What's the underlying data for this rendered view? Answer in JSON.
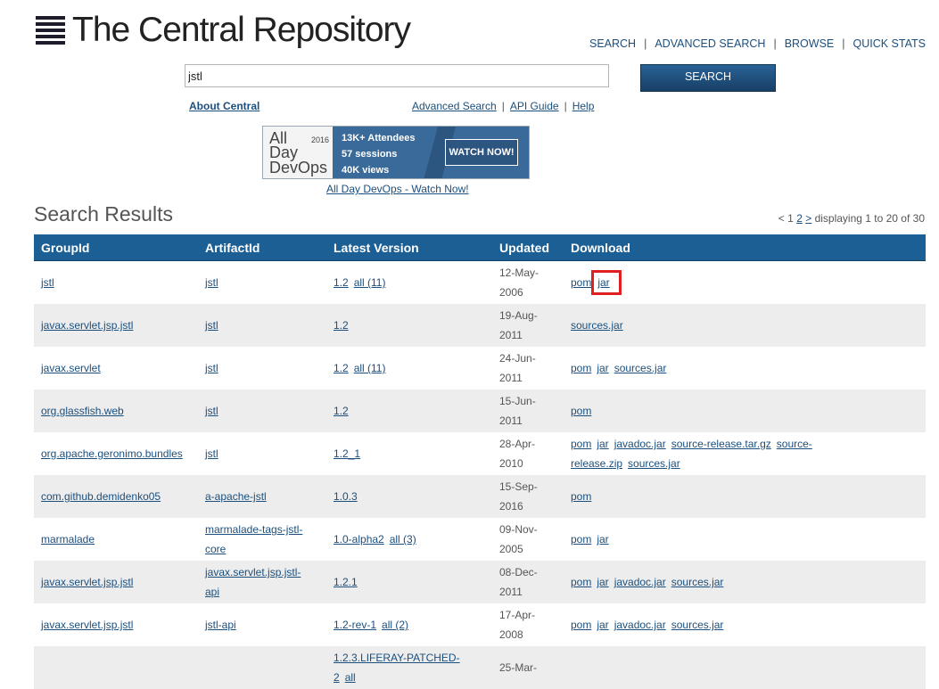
{
  "site": {
    "title": "The Central Repository"
  },
  "topnav": [
    "SEARCH",
    "ADVANCED SEARCH",
    "BROWSE",
    "QUICK STATS"
  ],
  "search": {
    "value": "jstl",
    "button_label": "SEARCH"
  },
  "about_link": "About Central",
  "sublinks": [
    "Advanced Search",
    "API Guide",
    "Help"
  ],
  "banner": {
    "brand_line1": "All",
    "brand_line2": "Day",
    "brand_line3": "DevOps",
    "year": "2016",
    "stat1": "13K+ Attendees",
    "stat2": "57 sessions",
    "stat3": "40K views",
    "cta": "WATCH NOW!",
    "link": "All Day DevOps - Watch Now!"
  },
  "results": {
    "title": "Search Results",
    "paging": {
      "prev": "<",
      "page1": "1",
      "page2": "2",
      "next": ">",
      "summary": "displaying 1 to 20 of 30"
    },
    "columns": [
      "GroupId",
      "ArtifactId",
      "Latest Version",
      "Updated",
      "Download"
    ],
    "rows": [
      {
        "group": "jstl",
        "artifact": "jstl",
        "version": "1.2",
        "all": "all (11)",
        "updated": "12-May-2006",
        "downloads": [
          "pom",
          "jar"
        ]
      },
      {
        "group": "javax.servlet.jsp.jstl",
        "artifact": "jstl",
        "version": "1.2",
        "all": "",
        "updated": "19-Aug-2011",
        "downloads": [
          "sources.jar"
        ]
      },
      {
        "group": "javax.servlet",
        "artifact": "jstl",
        "version": "1.2",
        "all": "all (11)",
        "updated": "24-Jun-2011",
        "downloads": [
          "pom",
          "jar",
          "sources.jar"
        ]
      },
      {
        "group": "org.glassfish.web",
        "artifact": "jstl",
        "version": "1.2",
        "all": "",
        "updated": "15-Jun-2011",
        "downloads": [
          "pom"
        ]
      },
      {
        "group": "org.apache.geronimo.bundles",
        "artifact": "jstl",
        "version": "1.2_1",
        "all": "",
        "updated": "28-Apr-2010",
        "downloads": [
          "pom",
          "jar",
          "javadoc.jar",
          "source-release.tar.gz",
          "source-release.zip",
          "sources.jar"
        ]
      },
      {
        "group": "com.github.demidenko05",
        "artifact": "a-apache-jstl",
        "version": "1.0.3",
        "all": "",
        "updated": "15-Sep-2016",
        "downloads": [
          "pom"
        ]
      },
      {
        "group": "marmalade",
        "artifact": "marmalade-tags-jstl-core",
        "version": "1.0-alpha2",
        "all": "all (3)",
        "updated": "09-Nov-2005",
        "downloads": [
          "pom",
          "jar"
        ]
      },
      {
        "group": "javax.servlet.jsp.jstl",
        "artifact": "javax.servlet.jsp.jstl-api",
        "version": "1.2.1",
        "all": "",
        "updated": "08-Dec-2011",
        "downloads": [
          "pom",
          "jar",
          "javadoc.jar",
          "sources.jar"
        ]
      },
      {
        "group": "javax.servlet.jsp.jstl",
        "artifact": "jstl-api",
        "version": "1.2-rev-1",
        "all": "all (2)",
        "updated": "17-Apr-2008",
        "downloads": [
          "pom",
          "jar",
          "javadoc.jar",
          "sources.jar"
        ]
      },
      {
        "group": "",
        "artifact": "",
        "version": "1.2.3.LIFERAY-PATCHED-2",
        "all": "all",
        "updated": "25-Mar-",
        "downloads": []
      }
    ]
  },
  "highlight_color": "#e02020",
  "accent_color": "#1b5f94"
}
